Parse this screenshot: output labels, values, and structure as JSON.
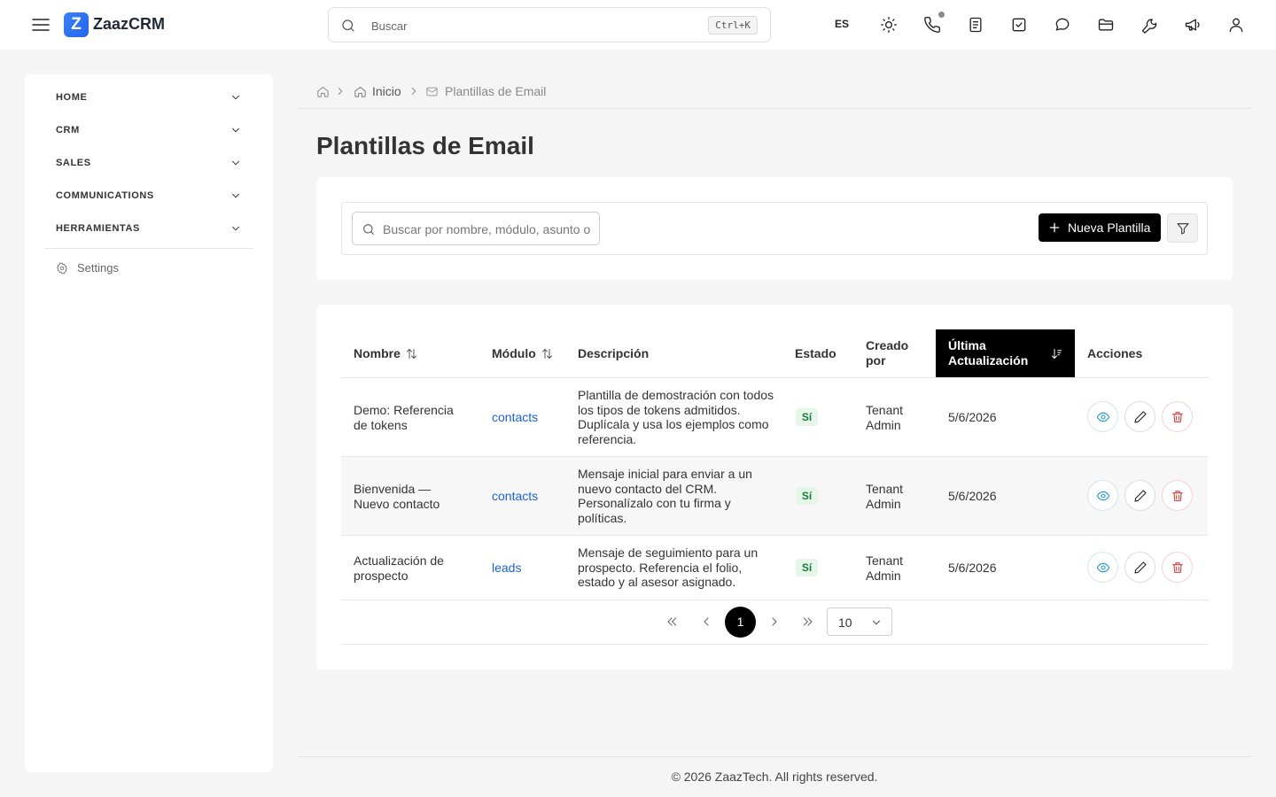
{
  "header": {
    "app_name": "ZaazCRM",
    "logo_letter": "Z",
    "search_placeholder": "Buscar",
    "search_shortcut": "Ctrl+K",
    "language": "ES",
    "icons": [
      "sun-icon",
      "phone-icon",
      "notes-icon",
      "tasks-icon",
      "chat-icon",
      "folder-icon",
      "tools-icon",
      "megaphone-icon",
      "user-icon"
    ]
  },
  "sidebar": {
    "sections": [
      {
        "label": "HOME"
      },
      {
        "label": "CRM"
      },
      {
        "label": "SALES"
      },
      {
        "label": "COMMUNICATIONS"
      },
      {
        "label": "HERRAMIENTAS"
      }
    ],
    "settings_label": "Settings"
  },
  "breadcrumb": {
    "home": "Inicio",
    "current": "Plantillas de Email"
  },
  "page": {
    "title": "Plantillas de Email"
  },
  "toolbar": {
    "search_placeholder": "Buscar por nombre, módulo, asunto o descripción",
    "new_button": "Nueva Plantilla"
  },
  "table": {
    "columns": {
      "name": "Nombre",
      "module": "Módulo",
      "description": "Descripción",
      "status": "Estado",
      "created_by": "Creado por",
      "updated": "Última Actualización",
      "actions": "Acciones"
    },
    "rows": [
      {
        "name": "Demo: Referencia de tokens",
        "module": "contacts",
        "description": "Plantilla de demostración con todos los tipos de tokens admitidos. Duplícala y usa los ejemplos como referencia.",
        "status": "Sí",
        "created_by": "Tenant Admin",
        "updated": "5/6/2026"
      },
      {
        "name": "Bienvenida — Nuevo contacto",
        "module": "contacts",
        "description": "Mensaje inicial para enviar a un nuevo contacto del CRM. Personalízalo con tu firma y políticas.",
        "status": "Sí",
        "created_by": "Tenant Admin",
        "updated": "5/6/2026"
      },
      {
        "name": "Actualización de prospecto",
        "module": "leads",
        "description": "Mensaje de seguimiento para un prospecto. Referencia el folio, estado y al asesor asignado.",
        "status": "Sí",
        "created_by": "Tenant Admin",
        "updated": "5/6/2026"
      }
    ]
  },
  "pagination": {
    "current_page": "1",
    "page_size": "10"
  },
  "footer": {
    "text": "© 2026 ZaazTech. All rights reserved."
  }
}
